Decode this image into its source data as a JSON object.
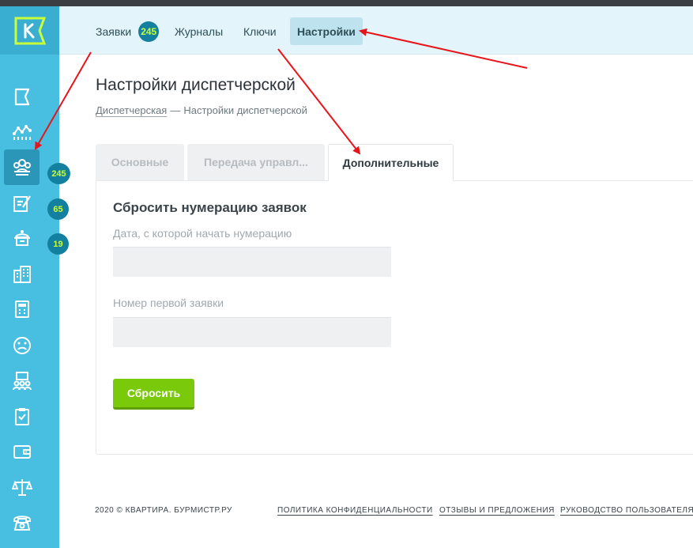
{
  "header": {
    "nav": [
      {
        "label": "Заявки",
        "badge": "245"
      },
      {
        "label": "Журналы"
      },
      {
        "label": "Ключи"
      },
      {
        "label": "Настройки",
        "active": true
      }
    ]
  },
  "sidebar": {
    "logo_icon": "k-logo-icon",
    "items": [
      {
        "icon": "flag-icon"
      },
      {
        "icon": "analytics-icon"
      },
      {
        "icon": "requests-icon",
        "badge": "245",
        "active": true
      },
      {
        "icon": "edit-note-icon",
        "badge": "65"
      },
      {
        "icon": "service-icon",
        "badge": "19"
      },
      {
        "icon": "building-icon"
      },
      {
        "icon": "calculator-icon"
      },
      {
        "icon": "sad-face-icon"
      },
      {
        "icon": "people-board-icon"
      },
      {
        "icon": "clipboard-icon"
      },
      {
        "icon": "wallet-icon"
      },
      {
        "icon": "scales-icon"
      },
      {
        "icon": "phone-icon"
      }
    ]
  },
  "main": {
    "title": "Настройки диспетчерской",
    "breadcrumb": {
      "link": "Диспетчерская",
      "separator": "—",
      "current": "Настройки диспетчерской"
    },
    "tabs": [
      {
        "label": "Основные"
      },
      {
        "label": "Передача управл..."
      },
      {
        "label": "Дополнительные",
        "active": true
      }
    ],
    "section_title": "Сбросить нумерацию заявок",
    "fields": [
      {
        "label": "Дата, с которой начать нумерацию",
        "value": ""
      },
      {
        "label": "Номер первой заявки",
        "value": ""
      }
    ],
    "reset_button": "Сбросить"
  },
  "footer": {
    "copyright": "2020 © КВАРТИРА. БУРМИСТР.РУ",
    "links": [
      "ПОЛИТИКА КОНФИДЕНЦИАЛЬНОСТИ",
      "ОТЗЫВЫ И ПРЕДЛОЖЕНИЯ",
      "РУКОВОДСТВО ПОЛЬЗОВАТЕЛЯ"
    ]
  },
  "colors": {
    "sidebar": "#48bfe0",
    "badge": "#12809e",
    "badge_text": "#c7ff3b",
    "button": "#7ac90b",
    "annotation_arrow": "#e8141a"
  }
}
